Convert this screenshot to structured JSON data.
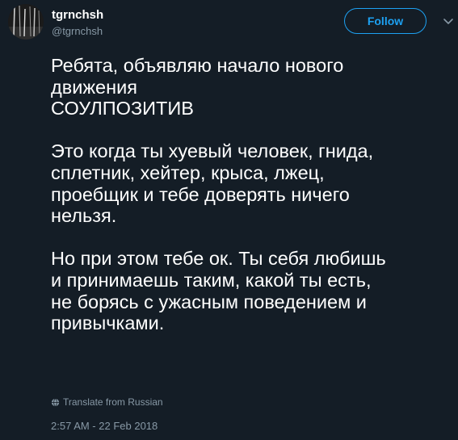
{
  "author": {
    "display_name": "tgrnchsh",
    "handle": "@tgrnchsh",
    "avatar_icon": "avatar-photo-icon"
  },
  "follow_button": {
    "label": "Follow"
  },
  "more_menu_icon": "chevron-down-icon",
  "tweet": {
    "text": "Ребята, объявляю начало нового\nдвижения\nСОУЛПОЗИТИВ\n\nЭто когда ты хуевый человек, гнида,\nсплетник, хейтер, крыса, лжец,\nпроебщик и тебе доверять ничего\nнельзя.\n\nНо при этом тебе ок. Ты себя любишь\nи принимаешь таким, какой ты есть,\nне борясь с ужасным поведением и\nпривычками.",
    "translate_label": "Translate from Russian",
    "timestamp": "2:57 AM - 22 Feb 2018"
  },
  "colors": {
    "background": "#141d26",
    "text": "#ffffff",
    "muted": "#8899a6",
    "accent": "#1da1f2"
  }
}
